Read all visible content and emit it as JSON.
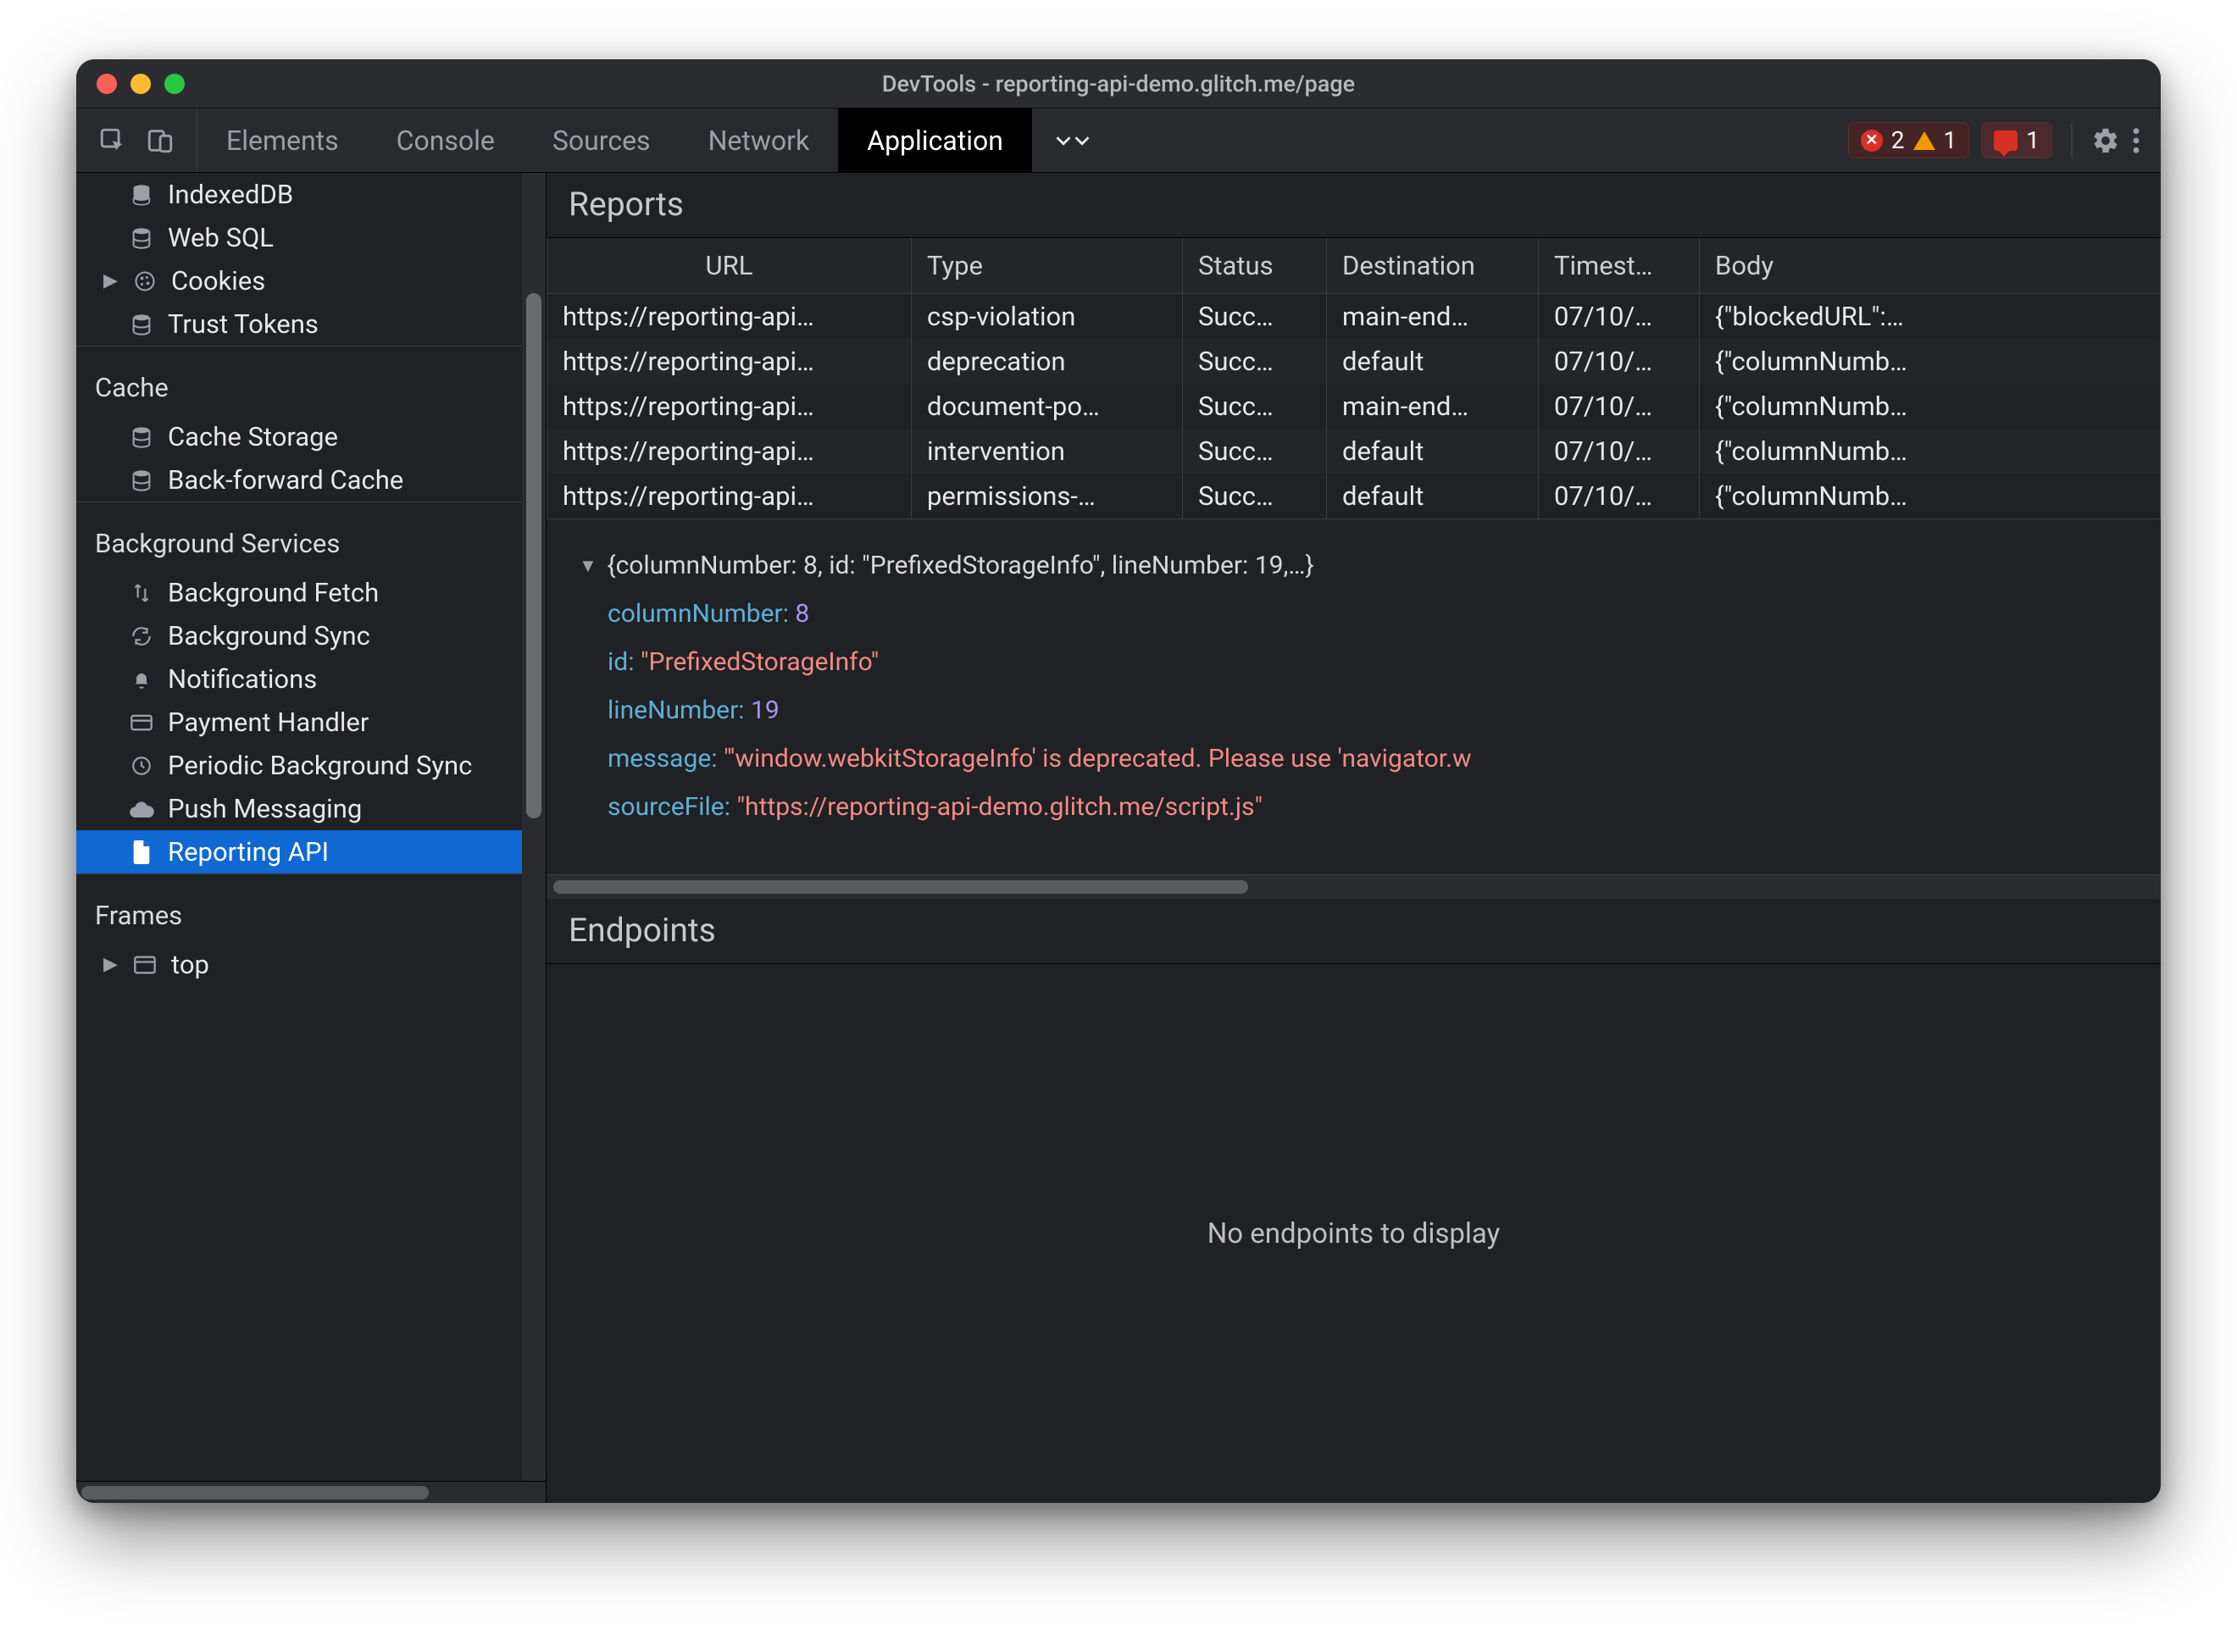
{
  "window": {
    "title": "DevTools - reporting-api-demo.glitch.me/page"
  },
  "tabs": {
    "items": [
      "Elements",
      "Console",
      "Sources",
      "Network",
      "Application"
    ],
    "active_index": 4
  },
  "status": {
    "errors": "2",
    "warnings": "1",
    "feedback": "1"
  },
  "sidebar": {
    "storage_items": [
      {
        "icon": "database",
        "label": "IndexedDB",
        "has_arrow": false
      },
      {
        "icon": "database",
        "label": "Web SQL",
        "has_arrow": false
      },
      {
        "icon": "cookie",
        "label": "Cookies",
        "has_arrow": true
      },
      {
        "icon": "database",
        "label": "Trust Tokens",
        "has_arrow": false
      }
    ],
    "cache_title": "Cache",
    "cache_items": [
      {
        "icon": "database",
        "label": "Cache Storage"
      },
      {
        "icon": "database",
        "label": "Back-forward Cache"
      }
    ],
    "bg_title": "Background Services",
    "bg_items": [
      {
        "icon": "updown",
        "label": "Background Fetch"
      },
      {
        "icon": "sync",
        "label": "Background Sync"
      },
      {
        "icon": "bell",
        "label": "Notifications"
      },
      {
        "icon": "card",
        "label": "Payment Handler"
      },
      {
        "icon": "clock",
        "label": "Periodic Background Sync"
      },
      {
        "icon": "cloud",
        "label": "Push Messaging"
      },
      {
        "icon": "file",
        "label": "Reporting API",
        "selected": true
      }
    ],
    "frames_title": "Frames",
    "frames_items": [
      {
        "icon": "frame",
        "label": "top",
        "has_arrow": true
      }
    ]
  },
  "reports": {
    "title": "Reports",
    "columns": [
      "URL",
      "Type",
      "Status",
      "Destination",
      "Timest…",
      "Body"
    ],
    "rows": [
      {
        "url": "https://reporting-api…",
        "type": "csp-violation",
        "status": "Succ…",
        "dest": "main-end…",
        "ts": "07/10/…",
        "body": "{\"blockedURL\":…"
      },
      {
        "url": "https://reporting-api…",
        "type": "deprecation",
        "status": "Succ…",
        "dest": "default",
        "ts": "07/10/…",
        "body": "{\"columnNumb…"
      },
      {
        "url": "https://reporting-api…",
        "type": "document-po…",
        "status": "Succ…",
        "dest": "main-end…",
        "ts": "07/10/…",
        "body": "{\"columnNumb…"
      },
      {
        "url": "https://reporting-api…",
        "type": "intervention",
        "status": "Succ…",
        "dest": "default",
        "ts": "07/10/…",
        "body": "{\"columnNumb…"
      },
      {
        "url": "https://reporting-api…",
        "type": "permissions-…",
        "status": "Succ…",
        "dest": "default",
        "ts": "07/10/…",
        "body": "{\"columnNumb…"
      }
    ]
  },
  "detail": {
    "root_summary": "{columnNumber: 8, id: \"PrefixedStorageInfo\", lineNumber: 19,…}",
    "columnNumber_key": "columnNumber:",
    "columnNumber_val": "8",
    "id_key": "id:",
    "id_val": "\"PrefixedStorageInfo\"",
    "lineNumber_key": "lineNumber:",
    "lineNumber_val": "19",
    "message_key": "message:",
    "message_val": "\"'window.webkitStorageInfo' is deprecated. Please use 'navigator.w",
    "sourceFile_key": "sourceFile:",
    "sourceFile_val": "\"https://reporting-api-demo.glitch.me/script.js\""
  },
  "endpoints": {
    "title": "Endpoints",
    "empty": "No endpoints to display"
  }
}
